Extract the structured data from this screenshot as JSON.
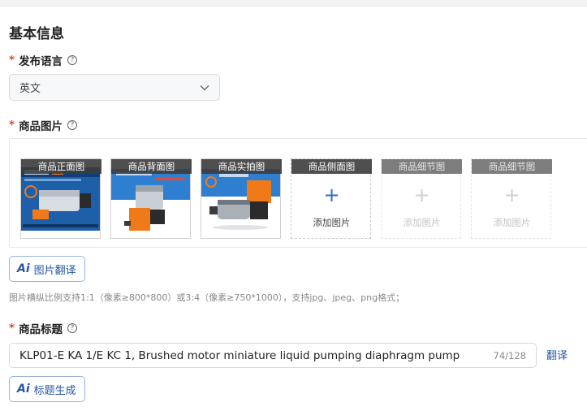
{
  "section": {
    "title": "基本信息"
  },
  "language": {
    "label": "发布语言",
    "required_mark": "*",
    "help": "?",
    "selected": "英文"
  },
  "images": {
    "label": "商品图片",
    "required_mark": "*",
    "help": "?",
    "slots": [
      {
        "caption": "商品正面图",
        "state": "uploaded"
      },
      {
        "caption": "商品背面图",
        "state": "uploaded"
      },
      {
        "caption": "商品实拍图",
        "state": "uploaded"
      },
      {
        "caption": "商品侧面图",
        "state": "empty",
        "add_label": "添加图片",
        "plus": "+"
      },
      {
        "caption": "商品细节图",
        "state": "disabled",
        "add_label": "添加图片",
        "plus": "+"
      },
      {
        "caption": "商品细节图",
        "state": "disabled",
        "add_label": "添加图片",
        "plus": "+"
      }
    ],
    "translate_button": {
      "ai": "Ai",
      "label": "图片翻译"
    },
    "hint": "图片横纵比例支持1:1（像素≥800*800）或3:4（像素≥750*1000），支持jpg、jpeg、png格式；"
  },
  "product_title": {
    "label": "商品标题",
    "required_mark": "*",
    "help": "?",
    "value": "KLP01-E KA 1/E KC 1, Brushed motor miniature liquid pumping diaphragm pump",
    "counter": "74/128",
    "translate_link": "翻译",
    "generate_button": {
      "ai": "Ai",
      "label": "标题生成"
    }
  },
  "colors": {
    "required": "#e8402f",
    "accent": "#2456a6",
    "pump_orange": "#f07a1a",
    "photo_blue": "#1d5fa8"
  }
}
